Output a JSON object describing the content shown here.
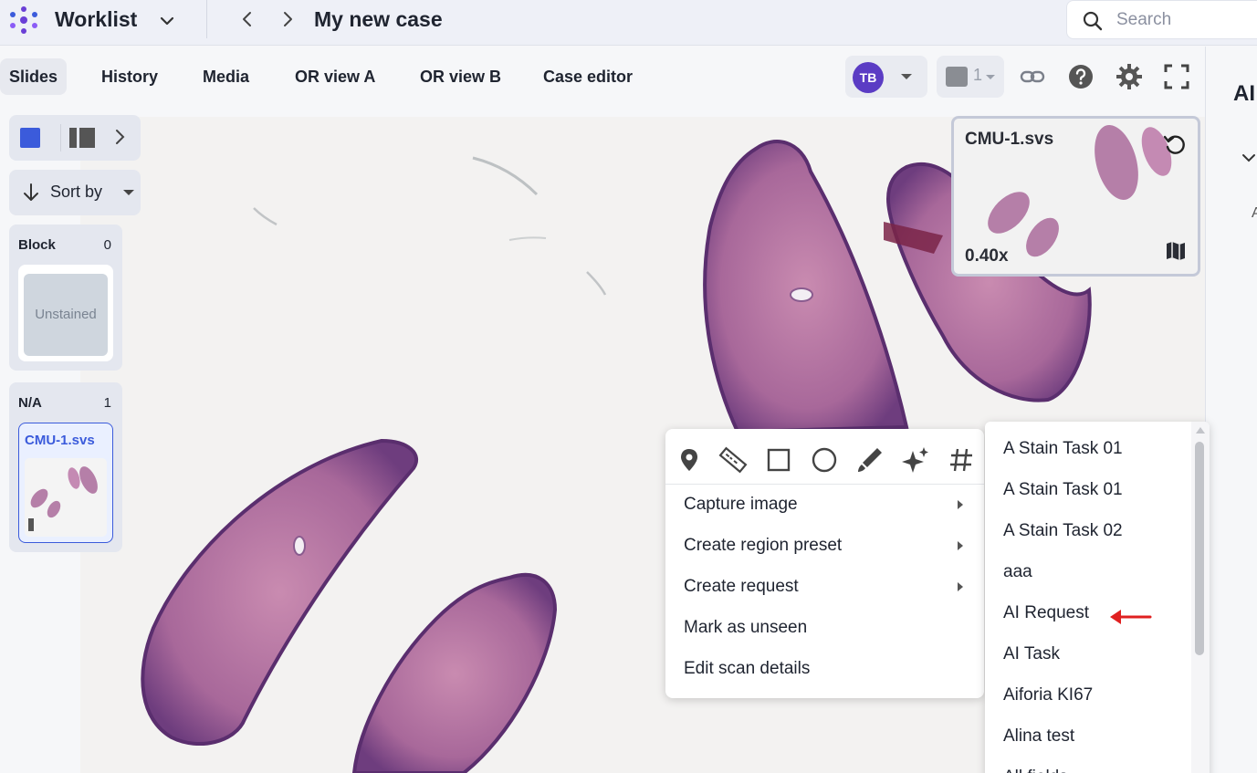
{
  "header": {
    "app_name": "Worklist",
    "case_title": "My new case",
    "search_placeholder": "Search"
  },
  "tabs": [
    {
      "label": "Slides",
      "active": true
    },
    {
      "label": "History"
    },
    {
      "label": "Media"
    },
    {
      "label": "OR view A"
    },
    {
      "label": "OR view B"
    },
    {
      "label": "Case editor"
    }
  ],
  "toolbar": {
    "user_initials": "TB",
    "layer_count": "1",
    "icons": [
      "link-icon",
      "help-icon",
      "settings-icon",
      "fullscreen-icon"
    ]
  },
  "right_panel": {
    "title": "AI",
    "subtitle": "A"
  },
  "sidebar": {
    "sort_label": "Sort by",
    "groups": [
      {
        "name": "Block",
        "count": "0",
        "card_label": "Unstained"
      },
      {
        "name": "N/A",
        "count": "1",
        "slide_name": "CMU-1.svs"
      }
    ]
  },
  "minimap": {
    "name": "CMU-1.svs",
    "zoom": "0.40x"
  },
  "context_menu": {
    "tools": [
      "pin-icon",
      "ruler-icon",
      "rectangle-icon",
      "circle-icon",
      "brush-icon",
      "sparkle-icon",
      "hash-icon"
    ],
    "items": [
      {
        "label": "Capture image",
        "has_submenu": true
      },
      {
        "label": "Create region preset",
        "has_submenu": true
      },
      {
        "label": "Create request",
        "has_submenu": true
      },
      {
        "label": "Mark as unseen",
        "has_submenu": false
      },
      {
        "label": "Edit scan details",
        "has_submenu": false
      }
    ]
  },
  "submenu": {
    "items": [
      "A Stain Task 01",
      "A Stain Task 01",
      "A Stain Task 02",
      "aaa",
      "AI Request",
      "AI Task",
      "Aiforia KI67",
      "Alina test",
      "All fields"
    ]
  },
  "colors": {
    "accent": "#3b5bdb",
    "avatar": "#5b3cc4",
    "annotation_arrow": "#e02020"
  }
}
